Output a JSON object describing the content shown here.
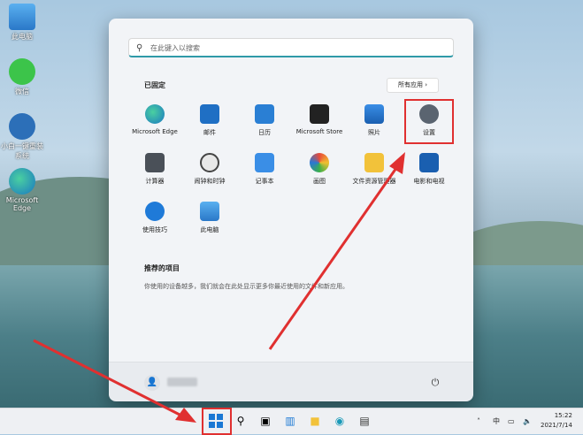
{
  "desktop": {
    "icons": [
      {
        "label": "此电脑"
      },
      {
        "label": "微信"
      },
      {
        "label": "小白一键重装系统"
      },
      {
        "label": "Microsoft Edge"
      }
    ]
  },
  "start_menu": {
    "search_placeholder": "在此键入以搜索",
    "pinned_title": "已固定",
    "all_apps_label": "所有应用",
    "pinned_apps": [
      {
        "label": "Microsoft Edge",
        "icon": "edge-icon"
      },
      {
        "label": "邮件",
        "icon": "mail-icon"
      },
      {
        "label": "日历",
        "icon": "calendar-icon"
      },
      {
        "label": "Microsoft Store",
        "icon": "store-icon"
      },
      {
        "label": "照片",
        "icon": "photos-icon"
      },
      {
        "label": "设置",
        "icon": "gear-icon"
      },
      {
        "label": "计算器",
        "icon": "calculator-icon"
      },
      {
        "label": "闹钟和时钟",
        "icon": "clock-icon"
      },
      {
        "label": "记事本",
        "icon": "notepad-icon"
      },
      {
        "label": "画图",
        "icon": "paint-icon"
      },
      {
        "label": "文件资源管理器",
        "icon": "folder-icon"
      },
      {
        "label": "电影和电视",
        "icon": "movies-icon"
      },
      {
        "label": "使用技巧",
        "icon": "tips-icon"
      },
      {
        "label": "此电脑",
        "icon": "computer-icon"
      }
    ],
    "recommended_title": "推荐的项目",
    "recommended_desc": "你使用的设备越多，我们就会在此处显示更多你最近使用的文件和新应用。"
  },
  "taskbar": {
    "tray_lang": "中",
    "time": "15:22",
    "date": "2021/7/14"
  },
  "colors": {
    "highlight_red": "#e03030",
    "accent": "#2f9aa8"
  }
}
